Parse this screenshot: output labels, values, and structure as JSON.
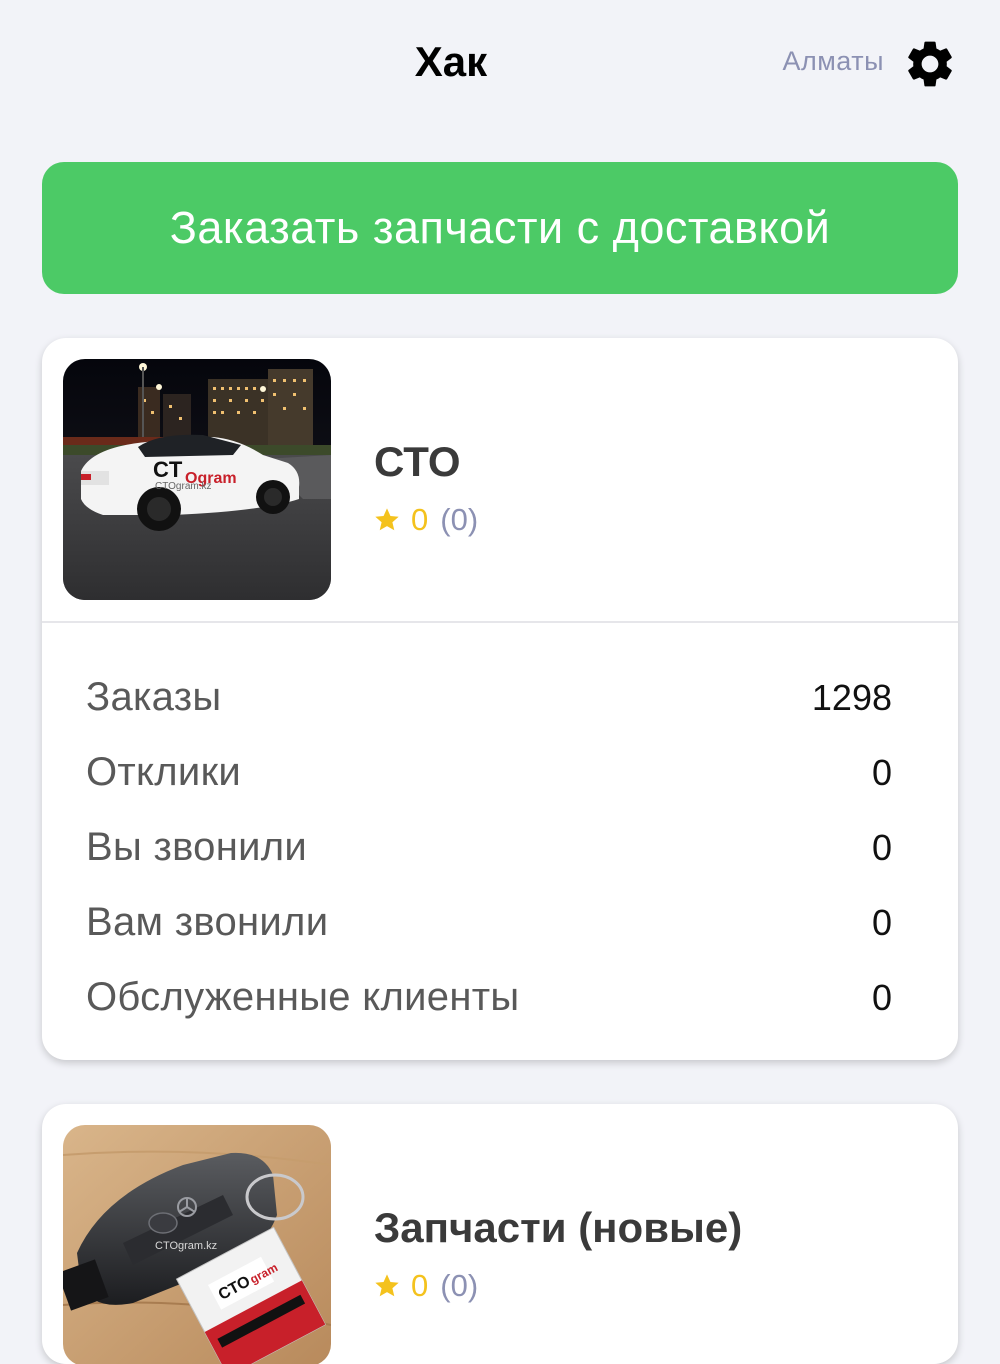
{
  "header": {
    "title": "Хак",
    "city": "Алматы",
    "settings_icon": "gear-icon"
  },
  "order_button": {
    "label": "Заказать запчасти с доставкой",
    "color": "#4cca66"
  },
  "cards": [
    {
      "title": "СТО",
      "rating": "0",
      "reviews": "(0)",
      "image_icon": "car-photo",
      "stats": [
        {
          "label": "Заказы",
          "value": "1298"
        },
        {
          "label": "Отклики",
          "value": "0"
        },
        {
          "label": "Вы звонили",
          "value": "0"
        },
        {
          "label": "Вам звонили",
          "value": "0"
        },
        {
          "label": "Обслуженные клиенты",
          "value": "0"
        }
      ]
    },
    {
      "title": "Запчасти (новые)",
      "rating": "0",
      "reviews": "(0)",
      "image_icon": "car-key-photo"
    }
  ],
  "colors": {
    "background": "#f2f3f8",
    "accent_green": "#4cca66",
    "star_yellow": "#f4c21d",
    "muted": "#8c91b3"
  }
}
